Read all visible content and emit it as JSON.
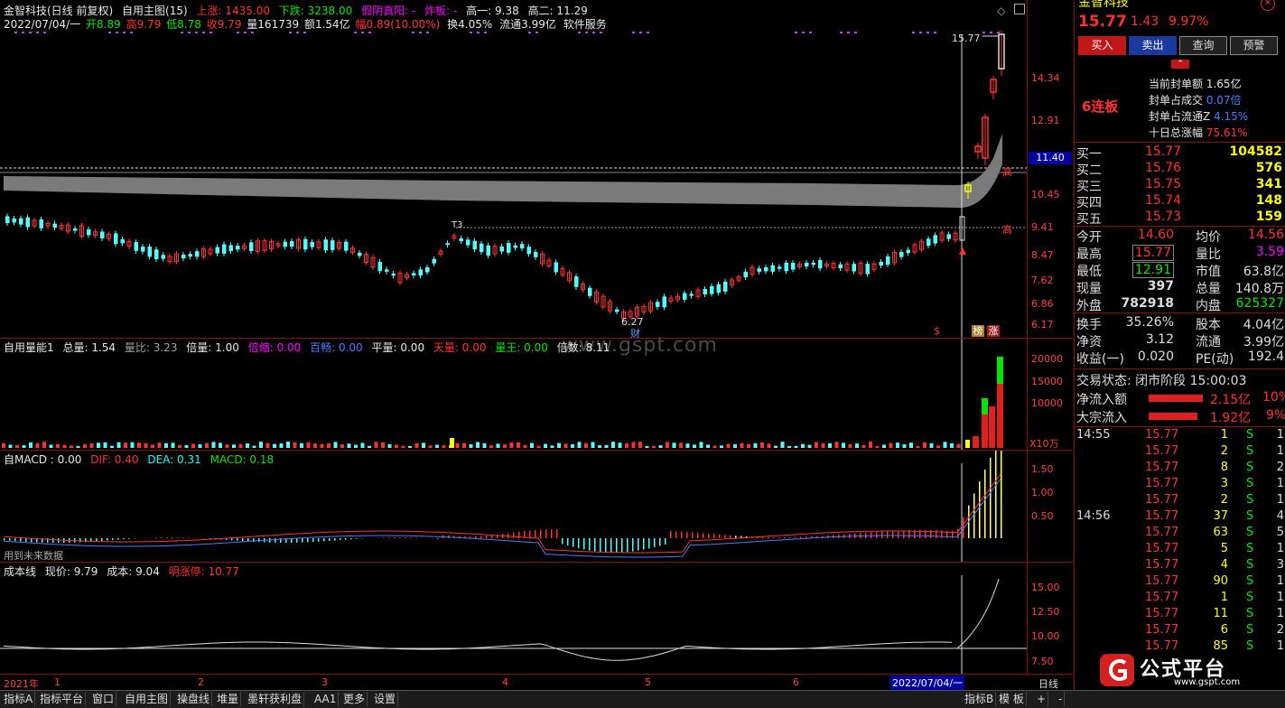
{
  "header": {
    "stock_name": "金智科技(日线 前复权)",
    "main_indicator": "自用主图(15)",
    "up_label": "上涨: 1435.00",
    "down_label": "下跌: 3238.00",
    "yinyang_label": "假阴真阳: -",
    "blast_label": "炸板: -",
    "high1_label": "高一: 9.38",
    "high2_label": "高二: 11.29"
  },
  "quote_line": {
    "date": "2022/07/04/一",
    "open": "开8.89",
    "high": "高9.79",
    "low": "低8.78",
    "close": "收9.79",
    "volume": "量161739",
    "amount": "额1.54亿",
    "change": "幅0.89(10.00%)",
    "turnover": "换4.05%",
    "float": "流通3.99亿",
    "sector": "软件服务"
  },
  "price_axis": [
    "14.34",
    "12.91",
    "11.40",
    "10.45",
    "9.41",
    "8.47",
    "7.62",
    "6.86",
    "6.17"
  ],
  "price_marks": {
    "peak": "15.77",
    "low": "6.27",
    "tag_high": "高",
    "tag_high2": "高",
    "badge_t3": "T3",
    "badge_fin": "财",
    "badge_bang": "榜",
    "badge_zhang": "涨",
    "badge_dollar": "$"
  },
  "volume_panel": {
    "name": "自用量能1",
    "total": "总量: 1.54",
    "ratio": "量比: 3.23",
    "double": "倍量: 1.00",
    "shrink": "倍缩: 0.00",
    "hundred": "百畅: 0.00",
    "flat": "平量: 0.00",
    "sky": "天量: 0.00",
    "king": "量王: 0.00",
    "multiple": "倍数: 8.11",
    "axis": [
      "20000",
      "15000",
      "10000"
    ],
    "unit": "X10万"
  },
  "macd_panel": {
    "name": "自MACD : 0.00",
    "dif": "DIF: 0.40",
    "dea": "DEA: 0.31",
    "macd": "MACD: 0.18",
    "note": "用到未来数据",
    "axis": [
      "1.50",
      "1.00",
      "0.50"
    ]
  },
  "cost_panel": {
    "name": "成本线",
    "price": "现价: 9.79",
    "cost": "成本: 9.04",
    "limit": "明涨停: 10.77",
    "axis": [
      "15.00",
      "12.50",
      "10.00",
      "7.50"
    ]
  },
  "date_axis": {
    "labels": [
      "2021年",
      "1",
      "2",
      "3",
      "4",
      "5",
      "6"
    ],
    "current": "2022/07/04/一",
    "period": "日线"
  },
  "watermark": "www.gspt.com",
  "right_panel": {
    "title": "金智科技",
    "price": "15.77",
    "change": "1.43",
    "pct": "9.97%",
    "buttons": [
      "买入",
      "卖出",
      "查询",
      "预警"
    ],
    "limit_info": [
      {
        "label": "当前封单额",
        "value": "1.65亿"
      },
      {
        "label": "封单占成交",
        "value": "0.07倍"
      },
      {
        "label": "封单占流通Z",
        "value": "4.15%"
      },
      {
        "label": "十日总涨幅",
        "value": "75.61%"
      }
    ],
    "board_tag": "6连板",
    "bids": [
      {
        "label": "买一",
        "price": "15.77",
        "vol": "104582"
      },
      {
        "label": "买二",
        "price": "15.76",
        "vol": "576"
      },
      {
        "label": "买三",
        "price": "15.75",
        "vol": "341"
      },
      {
        "label": "买四",
        "price": "15.74",
        "vol": "148"
      },
      {
        "label": "买五",
        "price": "15.73",
        "vol": "159"
      }
    ],
    "stats": [
      {
        "l1": "今开",
        "v1": "14.60",
        "l2": "均价",
        "v2": "14.56"
      },
      {
        "l1": "最高",
        "v1": "15.77",
        "l2": "量比",
        "v2": "3.59"
      },
      {
        "l1": "最低",
        "v1": "12.91",
        "l2": "市值",
        "v2": "63.8亿"
      },
      {
        "l1": "现量",
        "v1": "397",
        "l2": "总量",
        "v2": "140.8万"
      },
      {
        "l1": "外盘",
        "v1": "782918",
        "l2": "内盘",
        "v2": "625327"
      }
    ],
    "stats2": [
      {
        "l1": "换手",
        "v1": "35.26%",
        "l2": "股本",
        "v2": "4.04亿"
      },
      {
        "l1": "净资",
        "v1": "3.12",
        "l2": "流通",
        "v2": "3.99亿"
      },
      {
        "l1": "收益(一)",
        "v1": "0.020",
        "l2": "PE(动)",
        "v2": "192.4"
      }
    ],
    "trade_status": "交易状态: 闭市阶段 15:00:03",
    "net_inflow": {
      "label": "净流入额",
      "value": "2.15亿",
      "pct": "10%"
    },
    "big_inflow": {
      "label": "大宗流入",
      "value": "1.92亿",
      "pct": "9%"
    },
    "ticks": [
      {
        "time": "14:55",
        "price": "15.77",
        "vol": "1",
        "side": "S",
        "n": "1"
      },
      {
        "time": "",
        "price": "15.77",
        "vol": "2",
        "side": "S",
        "n": "1"
      },
      {
        "time": "",
        "price": "15.77",
        "vol": "8",
        "side": "S",
        "n": "2"
      },
      {
        "time": "",
        "price": "15.77",
        "vol": "3",
        "side": "S",
        "n": "1"
      },
      {
        "time": "",
        "price": "15.77",
        "vol": "2",
        "side": "S",
        "n": "1"
      },
      {
        "time": "14:56",
        "price": "15.77",
        "vol": "37",
        "side": "S",
        "n": "4"
      },
      {
        "time": "",
        "price": "15.77",
        "vol": "63",
        "side": "S",
        "n": "5"
      },
      {
        "time": "",
        "price": "15.77",
        "vol": "5",
        "side": "S",
        "n": "1"
      },
      {
        "time": "",
        "price": "15.77",
        "vol": "4",
        "side": "S",
        "n": "3"
      },
      {
        "time": "",
        "price": "15.77",
        "vol": "90",
        "side": "S",
        "n": "1"
      },
      {
        "time": "",
        "price": "15.77",
        "vol": "1",
        "side": "S",
        "n": "1"
      },
      {
        "time": "",
        "price": "15.77",
        "vol": "11",
        "side": "S",
        "n": "1"
      },
      {
        "time": "",
        "price": "15.77",
        "vol": "6",
        "side": "S",
        "n": "2"
      },
      {
        "time": "",
        "price": "15.77",
        "vol": "85",
        "side": "S",
        "n": "1"
      }
    ]
  },
  "tabs": [
    "指标A",
    "指标平台",
    "窗口",
    "自用主图",
    "操盘线",
    "堆量",
    "墨轩获利盘",
    "AA1",
    "更多",
    "设置"
  ],
  "tabs_right": [
    "指标B",
    "模 板",
    "+",
    "-"
  ],
  "logo": {
    "text": "公式平台",
    "url_text": "www.gspt.com"
  }
}
